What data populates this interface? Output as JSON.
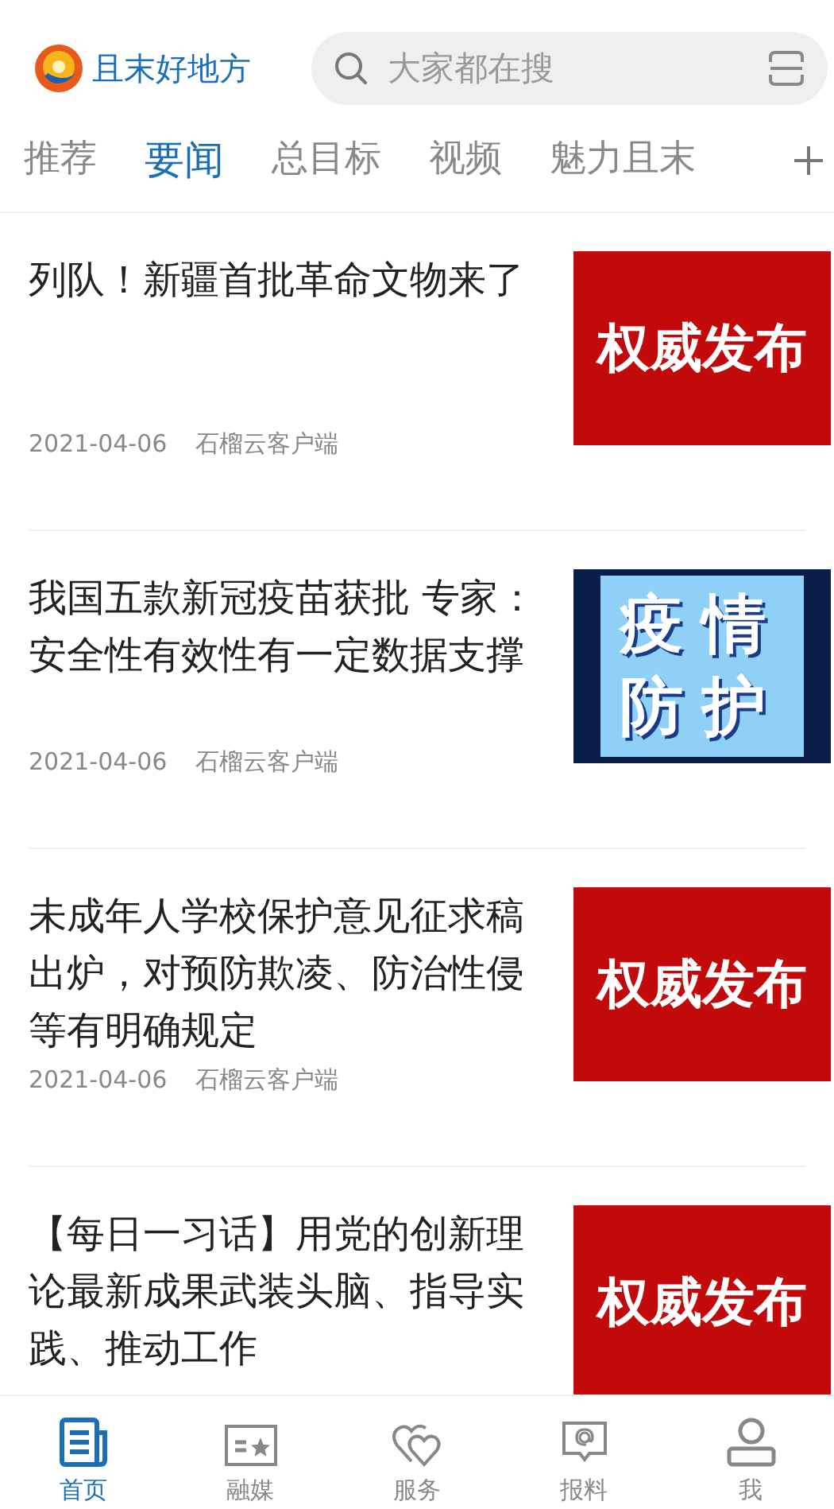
{
  "header": {
    "app_name": "且末好地方",
    "search": {
      "placeholder": "大家都在搜"
    }
  },
  "tabs": [
    {
      "label": "推荐",
      "selected": false
    },
    {
      "label": "要闻",
      "selected": true
    },
    {
      "label": "总目标",
      "selected": false
    },
    {
      "label": "视频",
      "selected": false
    },
    {
      "label": "魅力且末",
      "selected": false
    }
  ],
  "articles": [
    {
      "title": "列队！新疆首批革命文物来了",
      "date": "2021-04-06",
      "source": "石榴云客户端",
      "thumb": {
        "kind": "red",
        "text": [
          "权威发布"
        ]
      }
    },
    {
      "title": "我国五款新冠疫苗获批 专家：安全性有效性有一定数据支撑",
      "date": "2021-04-06",
      "source": "石榴云客户端",
      "thumb": {
        "kind": "blue",
        "text": [
          "疫情",
          "防护"
        ]
      }
    },
    {
      "title": "未成年人学校保护意见征求稿出炉，对预防欺凌、防治性侵等有明确规定",
      "date": "2021-04-06",
      "source": "石榴云客户端",
      "thumb": {
        "kind": "red",
        "text": [
          "权威发布"
        ]
      }
    },
    {
      "title": "【每日一习话】用党的创新理论最新成果武装头脑、指导实践、推动工作",
      "thumb": {
        "kind": "red",
        "text": [
          "权威发布"
        ]
      }
    }
  ],
  "bottom_nav": [
    {
      "label": "首页",
      "selected": true
    },
    {
      "label": "融媒",
      "selected": false
    },
    {
      "label": "服务",
      "selected": false
    },
    {
      "label": "报料",
      "selected": false
    },
    {
      "label": "我",
      "selected": false
    }
  ]
}
